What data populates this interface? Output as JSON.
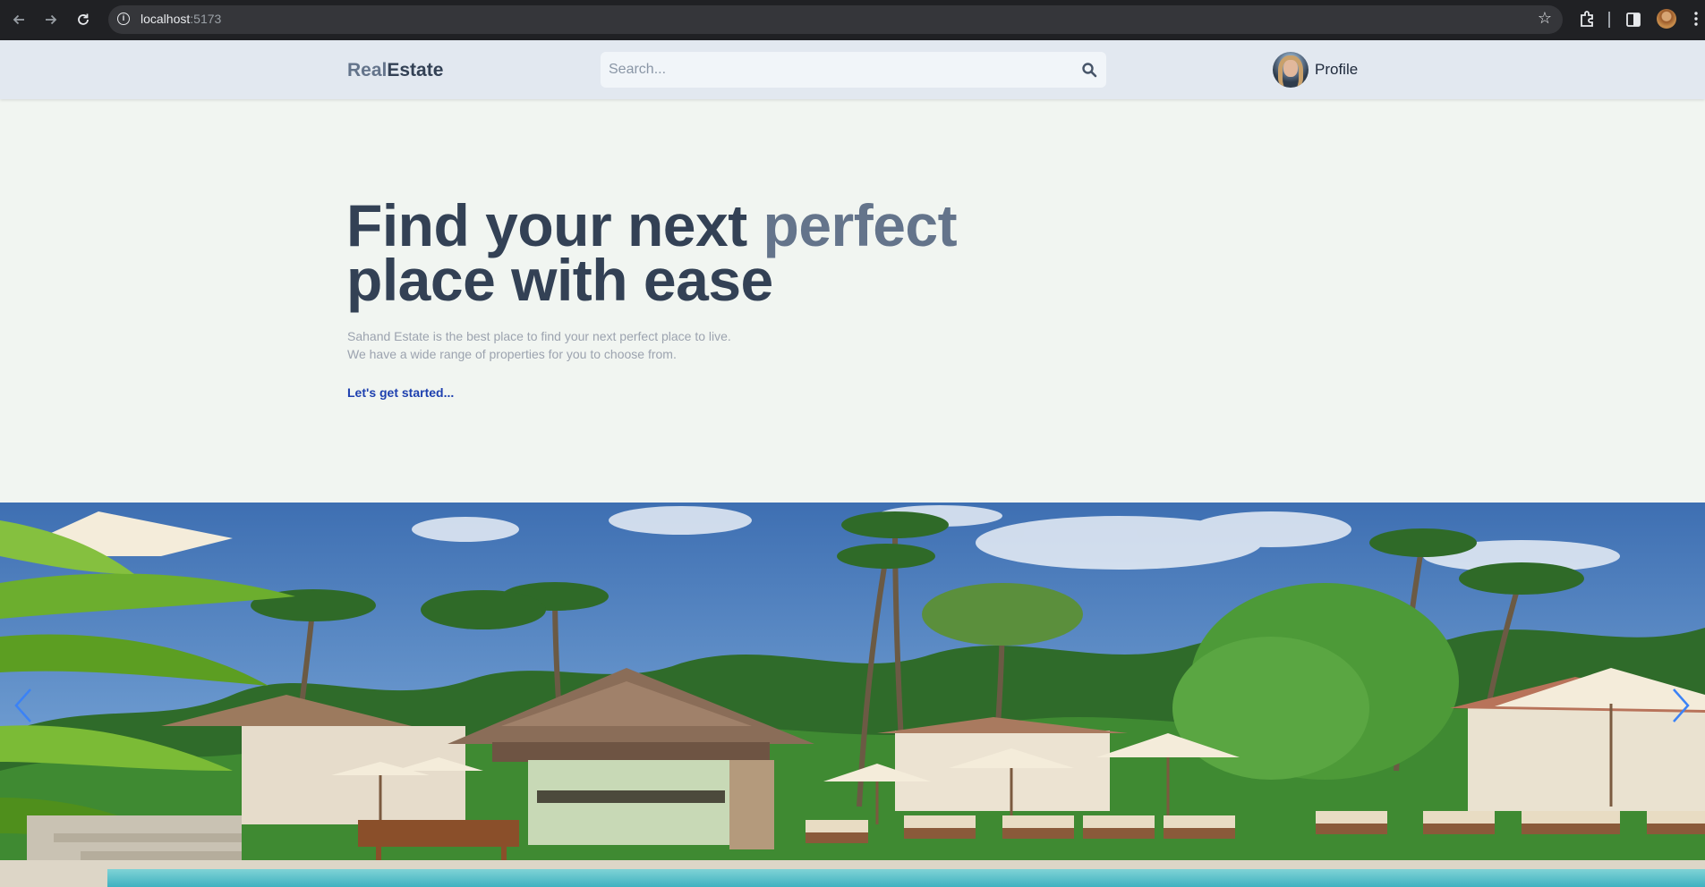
{
  "browser": {
    "url_host": "localhost",
    "url_port": ":5173",
    "icons": [
      "back-arrow-icon",
      "forward-arrow-icon",
      "reload-icon",
      "site-info-icon",
      "bookmark-star-icon",
      "extensions-icon",
      "side-panel-icon",
      "browser-profile-avatar",
      "browser-menu-icon"
    ]
  },
  "header": {
    "logo_part1": "Real",
    "logo_part2": "Estate",
    "search_placeholder": "Search...",
    "profile_label": "Profile"
  },
  "hero": {
    "title_line1_start": "Find your next ",
    "title_accent": "perfect",
    "title_line2": "place with ease",
    "description_line1": "Sahand Estate is the best place to find your next perfect place to live.",
    "description_line2": "We have a wide range of properties for you to choose from.",
    "cta_label": "Let's get started..."
  },
  "slider": {
    "image_subject": "tropical resort pool with palm trees and umbrellas",
    "prev_icon": "chevron-left-icon",
    "next_icon": "chevron-right-icon"
  },
  "colors": {
    "page_bg": "#f1f5f1",
    "header_bg": "#e2e8f0",
    "title": "#334155",
    "title_accent": "#64748b",
    "cta": "#1e40af",
    "slider_arrow": "#3b82f6"
  }
}
